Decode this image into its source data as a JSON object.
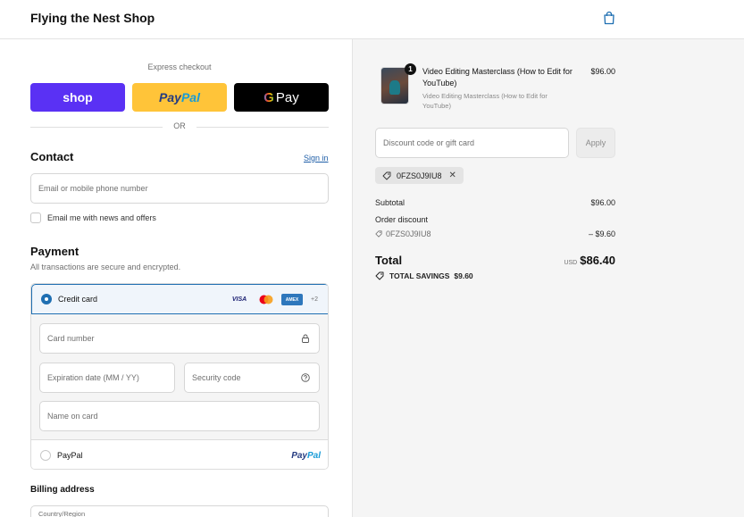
{
  "header": {
    "shop_name": "Flying the Nest Shop"
  },
  "express": {
    "label": "Express checkout",
    "shop_label": "shop",
    "paypal_pay": "Pay",
    "paypal_pal": "Pal",
    "gpay_g": "G",
    "gpay_label": "Pay",
    "or_label": "OR"
  },
  "contact": {
    "title": "Contact",
    "sign_in": "Sign in",
    "email_placeholder": "Email or mobile phone number",
    "newsletter_label": "Email me with news and offers"
  },
  "payment": {
    "title": "Payment",
    "subtitle": "All transactions are secure and encrypted.",
    "credit_card_label": "Credit card",
    "card_brands": {
      "visa": "VISA",
      "amex": "AMEX",
      "more": "+2"
    },
    "card_number_placeholder": "Card number",
    "expiry_placeholder": "Expiration date (MM / YY)",
    "security_placeholder": "Security code",
    "name_placeholder": "Name on card",
    "paypal_label": "PayPal",
    "paypal_logo_pay": "Pay",
    "paypal_logo_pal": "Pal"
  },
  "billing": {
    "title": "Billing address",
    "country_label": "Country/Region"
  },
  "order": {
    "quantity": "1",
    "product_title": "Video Editing Masterclass (How to Edit for YouTube)",
    "product_subtitle": "Video Editing Masterclass (How to Edit for YouTube)",
    "product_price": "$96.00",
    "discount_placeholder": "Discount code or gift card",
    "apply_label": "Apply",
    "applied_code": "0FZS0J9IU8",
    "subtotal_label": "Subtotal",
    "subtotal_value": "$96.00",
    "discount_label": "Order discount",
    "discount_code": "0FZS0J9IU8",
    "discount_value": "– $9.60",
    "total_label": "Total",
    "currency": "USD",
    "total_value": "$86.40",
    "savings_label": "TOTAL SAVINGS",
    "savings_value": "$9.60"
  },
  "colors": {
    "shop_pay": "#5a31f4",
    "paypal": "#ffc439",
    "accent": "#1f6fb2",
    "link": "#1f5fa8"
  }
}
